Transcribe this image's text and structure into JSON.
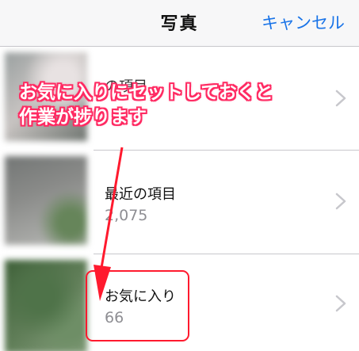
{
  "navbar": {
    "title": "写真",
    "cancel_label": "キャンセル"
  },
  "albums": [
    {
      "title": "の項目",
      "count": ""
    },
    {
      "title": "最近の項目",
      "count": "2,075"
    },
    {
      "title": "お気に入り",
      "count": "66"
    }
  ],
  "annotation": {
    "text": "お気に入りにセットしておくと\n作業が捗ります",
    "color": "#ff2a62"
  },
  "colors": {
    "accent": "#1a74e8",
    "highlight": "#ff1a2e"
  }
}
